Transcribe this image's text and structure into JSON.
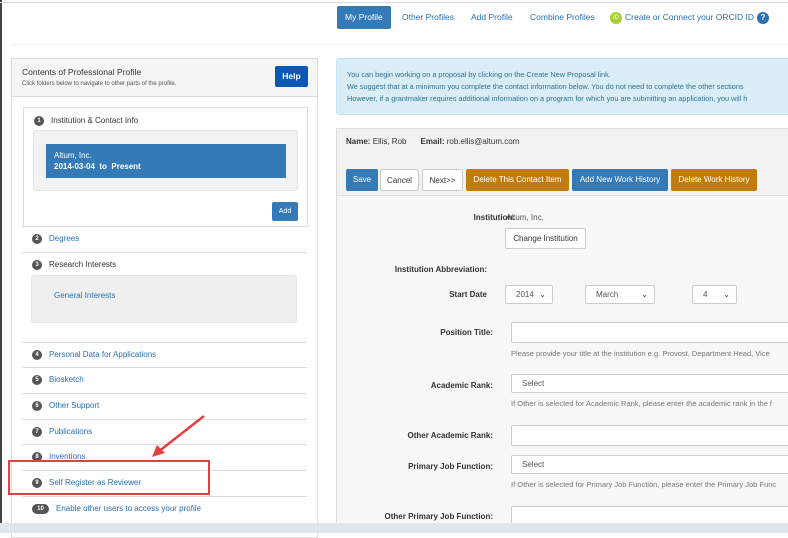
{
  "nav": {
    "tabs": [
      "My Profile",
      "Other Profiles",
      "Add Profile",
      "Combine Profiles"
    ],
    "orcid_label": "Create or Connect your ORCID ID",
    "orcid_icon": "iD",
    "help_icon": "?"
  },
  "sidebar": {
    "title": "Contents of Professional Profile",
    "subtitle": "Click folders below to navigate to other parts of the profile.",
    "help_label": "Help",
    "section1": {
      "num": "1",
      "label": "Institution & Contact Info",
      "entry_name": "Altum, Inc.",
      "entry_dates": "2014-03-04  to  Present",
      "add_label": "Add"
    },
    "degrees": {
      "num": "2",
      "label": "Degrees"
    },
    "research": {
      "num": "3",
      "label": "Research Interests",
      "sub": "General Interests"
    },
    "items": [
      {
        "num": "4",
        "label": "Personal Data for Applications"
      },
      {
        "num": "5",
        "label": "Biosketch"
      },
      {
        "num": "6",
        "label": "Other Support"
      },
      {
        "num": "7",
        "label": "Publications"
      },
      {
        "num": "8",
        "label": "Inventions"
      },
      {
        "num": "9",
        "label": "Self Register as Reviewer"
      },
      {
        "num": "10",
        "label": "Enable other users to access your profile"
      }
    ]
  },
  "info": {
    "lines": [
      "You can begin working on a proposal by clicking on the Create New Proposal link.",
      "We suggest that at a minimum you complete the contact information below. You do not need to complete the other sections",
      "However, if a grantmaker requires additional information on a program for which you are submitting an application, you will h"
    ]
  },
  "contact": {
    "name_label": "Name:",
    "name": "Ellis, Rob",
    "email_label": "Email:",
    "email": "rob.ellis@altum.com"
  },
  "toolbar": {
    "save": "Save",
    "cancel": "Cancel",
    "next": "Next>>",
    "delete_contact": "Delete This Contact Item",
    "add_work": "Add New Work History",
    "delete_work": "Delete Work History"
  },
  "colors": {
    "primary": "#337ab7",
    "warning": "#c27c0e",
    "info_bg": "#d9edf7",
    "highlight": "#e04040"
  },
  "form": {
    "institution_label": "Institution:",
    "institution": "Altum, Inc.",
    "change_institution": "Change Institution",
    "abbrev_label": "Institution Abbreviation:",
    "start_label": "Start Date",
    "year": "2014",
    "month": "March",
    "day": "4",
    "position_label": "Position Title:",
    "position_hint": "Please provide your title at the institution e.g. Provost, Department Head, Vice",
    "rank_label": "Academic Rank:",
    "rank_value": "Select",
    "rank_hint": "If Other is selected for Academic Rank, please enter the academic rank in the f",
    "other_rank_label": "Other Academic Rank:",
    "job_label": "Primary Job Function:",
    "job_value": "Select",
    "job_hint": "If Other is selected for Primary Job Function, please enter the Primary Job Func",
    "other_job_label": "Other Primary Job Function:"
  }
}
